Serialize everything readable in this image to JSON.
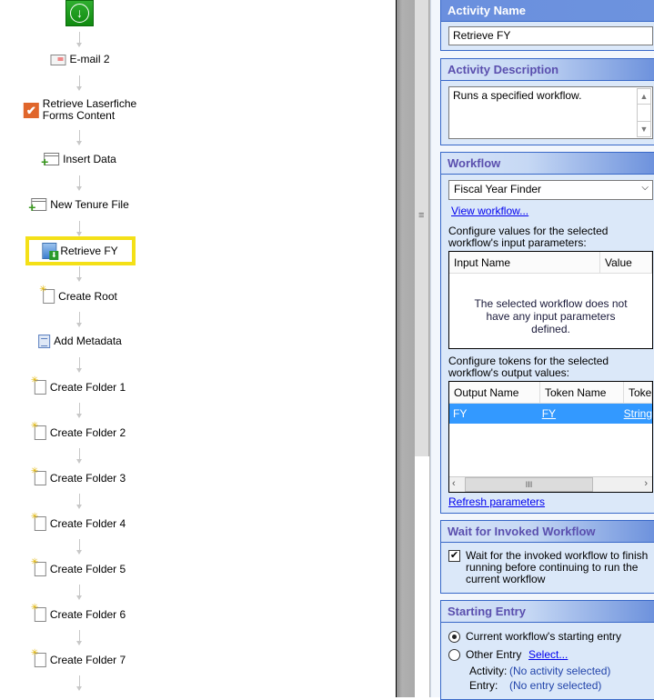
{
  "flow": {
    "start_icon": "start-arrow-icon",
    "nodes": [
      {
        "label": "E-mail 2",
        "icon": "email-icon"
      },
      {
        "label": "Retrieve Laserfiche Forms Content",
        "line1": "Retrieve Laserfiche",
        "line2": "Forms Content",
        "icon": "forms-check-icon"
      },
      {
        "label": "Insert Data",
        "icon": "insert-data-icon"
      },
      {
        "label": "New Tenure File",
        "icon": "insert-data-icon"
      },
      {
        "label": "Retrieve FY",
        "icon": "invoke-workflow-icon",
        "selected": true
      },
      {
        "label": "Create Root",
        "icon": "new-entry-icon"
      },
      {
        "label": "Add Metadata",
        "icon": "metadata-icon"
      },
      {
        "label": "Create Folder 1",
        "icon": "new-entry-icon"
      },
      {
        "label": "Create Folder 2",
        "icon": "new-entry-icon"
      },
      {
        "label": "Create Folder 3",
        "icon": "new-entry-icon"
      },
      {
        "label": "Create Folder 4",
        "icon": "new-entry-icon"
      },
      {
        "label": "Create Folder 5",
        "icon": "new-entry-icon"
      },
      {
        "label": "Create Folder 6",
        "icon": "new-entry-icon"
      },
      {
        "label": "Create Folder 7",
        "icon": "new-entry-icon"
      }
    ]
  },
  "panel": {
    "activity_name": {
      "header": "Activity Name",
      "value": "Retrieve FY"
    },
    "activity_description": {
      "header": "Activity Description",
      "value": "Runs a specified workflow."
    },
    "workflow": {
      "header": "Workflow",
      "selected": "Fiscal Year Finder",
      "view_link": "View workflow...",
      "input_text": "Configure values for the selected workflow's input parameters:",
      "input_columns": [
        "Input Name",
        "Value"
      ],
      "input_empty": "The selected workflow does not have any input parameters defined.",
      "output_text": "Configure tokens for the selected workflow's output values:",
      "output_columns": [
        "Output Name",
        "Token Name",
        "Toke"
      ],
      "output_rows": [
        {
          "output": "FY",
          "token": "FY",
          "type": "String"
        }
      ],
      "refresh_link": "Refresh parameters"
    },
    "wait": {
      "header": "Wait for Invoked Workflow",
      "checkbox_label": "Wait for the invoked workflow to finish running before continuing to run the current workflow",
      "checked": true
    },
    "starting_entry": {
      "header": "Starting Entry",
      "option_current": "Current workflow's starting entry",
      "option_other": "Other Entry",
      "select_link": "Select...",
      "activity_label": "Activity:",
      "activity_value": "(No activity selected)",
      "entry_label": "Entry:",
      "entry_value": "(No entry selected)",
      "selected": "current"
    }
  },
  "colors": {
    "highlight": "#f4e017",
    "header_blue": "#6b90dc",
    "selection": "#3399ff"
  }
}
